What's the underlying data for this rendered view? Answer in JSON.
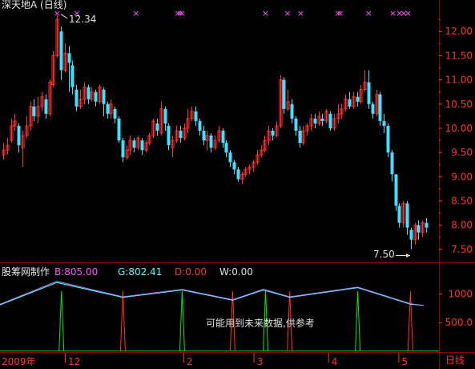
{
  "header": {
    "title": "深天地A (日线)"
  },
  "main_chart": {
    "high_label": "12.34",
    "low_label": "7.50",
    "y_ticks": [
      "12.00",
      "11.50",
      "11.00",
      "10.50",
      "10.00",
      "9.50",
      "9.00",
      "8.50",
      "8.00",
      "7.50"
    ],
    "signal_marker": "×"
  },
  "indicator": {
    "name": "股筹网制作",
    "b_label": "B:805.00",
    "g_label": "G:802.41",
    "d_label": "D:0.00",
    "w_label": "W:0.00",
    "y_ticks": [
      "1000",
      "500.0"
    ],
    "note": "可能用到未来数据,供参考",
    "colors": {
      "B": "#ff55ff",
      "G": "#55ffff",
      "D": "#ff3030",
      "W": "#e0e0e0"
    }
  },
  "time_axis": {
    "labels": [
      "2009年",
      "12",
      "2",
      "3",
      "4",
      "5"
    ],
    "period_button": "日线"
  },
  "colors": {
    "up": "#ff3030",
    "down": "#40e0ff",
    "grid": "#8b0000",
    "axis_text": "#ff3030",
    "signal": "#ff55ff"
  },
  "chart_data": {
    "type": "candlestick",
    "title": "深天地A (日线)",
    "price_ticks": [
      7.5,
      8.0,
      8.5,
      9.0,
      9.5,
      10.0,
      10.5,
      11.0,
      11.5,
      12.0
    ],
    "high_marked": 12.34,
    "low_marked": 7.5,
    "candles": [
      {
        "o": 9.45,
        "c": 9.55,
        "h": 9.7,
        "l": 9.35
      },
      {
        "o": 9.55,
        "c": 9.65,
        "h": 9.8,
        "l": 9.45
      },
      {
        "o": 9.75,
        "c": 10.05,
        "h": 10.2,
        "l": 9.7
      },
      {
        "o": 10.05,
        "c": 10.15,
        "h": 10.3,
        "l": 9.95
      },
      {
        "o": 10.05,
        "c": 9.65,
        "h": 10.1,
        "l": 9.5
      },
      {
        "o": 9.6,
        "c": 9.85,
        "h": 9.95,
        "l": 9.2
      },
      {
        "o": 9.85,
        "c": 10.05,
        "h": 10.25,
        "l": 9.8
      },
      {
        "o": 10.05,
        "c": 10.45,
        "h": 10.55,
        "l": 9.95
      },
      {
        "o": 10.45,
        "c": 10.25,
        "h": 10.6,
        "l": 10.15
      },
      {
        "o": 10.25,
        "c": 10.45,
        "h": 10.65,
        "l": 10.1
      },
      {
        "o": 10.45,
        "c": 10.65,
        "h": 10.75,
        "l": 10.35
      },
      {
        "o": 10.6,
        "c": 10.3,
        "h": 10.7,
        "l": 10.2
      },
      {
        "o": 10.3,
        "c": 10.95,
        "h": 11.0,
        "l": 10.25
      },
      {
        "o": 10.9,
        "c": 11.5,
        "h": 11.6,
        "l": 10.85
      },
      {
        "o": 11.5,
        "c": 12.25,
        "h": 12.34,
        "l": 11.45
      },
      {
        "o": 12.0,
        "c": 11.2,
        "h": 12.1,
        "l": 11.0
      },
      {
        "o": 11.2,
        "c": 11.55,
        "h": 11.75,
        "l": 11.15
      },
      {
        "o": 11.55,
        "c": 11.35,
        "h": 11.7,
        "l": 10.75
      },
      {
        "o": 11.3,
        "c": 10.85,
        "h": 11.4,
        "l": 10.7
      },
      {
        "o": 10.8,
        "c": 10.45,
        "h": 10.9,
        "l": 10.35
      },
      {
        "o": 10.45,
        "c": 10.6,
        "h": 10.8,
        "l": 10.4
      },
      {
        "o": 10.6,
        "c": 10.85,
        "h": 10.95,
        "l": 10.5
      },
      {
        "o": 10.85,
        "c": 10.6,
        "h": 10.9,
        "l": 10.5
      },
      {
        "o": 10.6,
        "c": 10.75,
        "h": 10.85,
        "l": 10.55
      },
      {
        "o": 10.75,
        "c": 10.55,
        "h": 10.8,
        "l": 10.45
      },
      {
        "o": 10.55,
        "c": 10.85,
        "h": 10.9,
        "l": 10.5
      },
      {
        "o": 10.8,
        "c": 10.5,
        "h": 10.85,
        "l": 10.25
      },
      {
        "o": 10.5,
        "c": 10.3,
        "h": 10.55,
        "l": 10.2
      },
      {
        "o": 10.3,
        "c": 10.5,
        "h": 10.6,
        "l": 10.2
      },
      {
        "o": 10.4,
        "c": 10.2,
        "h": 10.45,
        "l": 10.1
      },
      {
        "o": 10.2,
        "c": 9.75,
        "h": 10.25,
        "l": 9.7
      },
      {
        "o": 9.75,
        "c": 9.4,
        "h": 9.8,
        "l": 9.3
      },
      {
        "o": 9.4,
        "c": 9.55,
        "h": 9.65,
        "l": 9.35
      },
      {
        "o": 9.55,
        "c": 9.75,
        "h": 9.85,
        "l": 9.45
      },
      {
        "o": 9.75,
        "c": 9.6,
        "h": 9.8,
        "l": 9.5
      },
      {
        "o": 9.6,
        "c": 9.8,
        "h": 9.85,
        "l": 9.55
      },
      {
        "o": 9.75,
        "c": 9.55,
        "h": 9.8,
        "l": 9.45
      },
      {
        "o": 9.55,
        "c": 9.7,
        "h": 9.75,
        "l": 9.5
      },
      {
        "o": 9.7,
        "c": 9.85,
        "h": 9.9,
        "l": 9.65
      },
      {
        "o": 9.85,
        "c": 10.15,
        "h": 10.2,
        "l": 9.8
      },
      {
        "o": 10.1,
        "c": 9.95,
        "h": 10.2,
        "l": 9.85
      },
      {
        "o": 9.9,
        "c": 10.4,
        "h": 10.55,
        "l": 9.85
      },
      {
        "o": 10.4,
        "c": 10.1,
        "h": 10.45,
        "l": 9.95
      },
      {
        "o": 10.05,
        "c": 9.65,
        "h": 10.1,
        "l": 9.55
      },
      {
        "o": 9.6,
        "c": 9.75,
        "h": 9.85,
        "l": 9.4
      },
      {
        "o": 9.75,
        "c": 9.95,
        "h": 10.05,
        "l": 9.7
      },
      {
        "o": 9.95,
        "c": 9.8,
        "h": 10.05,
        "l": 9.7
      },
      {
        "o": 9.8,
        "c": 10.0,
        "h": 10.1,
        "l": 9.75
      },
      {
        "o": 10.0,
        "c": 10.2,
        "h": 10.4,
        "l": 9.9
      },
      {
        "o": 10.2,
        "c": 10.35,
        "h": 10.45,
        "l": 10.15
      },
      {
        "o": 10.35,
        "c": 10.15,
        "h": 10.45,
        "l": 10.05
      },
      {
        "o": 10.15,
        "c": 9.95,
        "h": 10.2,
        "l": 9.85
      },
      {
        "o": 9.95,
        "c": 9.75,
        "h": 10.05,
        "l": 9.65
      },
      {
        "o": 9.75,
        "c": 9.85,
        "h": 9.95,
        "l": 9.55
      },
      {
        "o": 9.85,
        "c": 9.6,
        "h": 9.9,
        "l": 9.5
      },
      {
        "o": 9.6,
        "c": 9.75,
        "h": 9.85,
        "l": 9.55
      },
      {
        "o": 9.75,
        "c": 9.95,
        "h": 10.05,
        "l": 9.7
      },
      {
        "o": 9.95,
        "c": 9.7,
        "h": 10.0,
        "l": 9.6
      },
      {
        "o": 9.7,
        "c": 9.5,
        "h": 9.75,
        "l": 9.4
      },
      {
        "o": 9.5,
        "c": 9.3,
        "h": 9.55,
        "l": 9.2
      },
      {
        "o": 9.3,
        "c": 9.15,
        "h": 9.35,
        "l": 9.05
      },
      {
        "o": 9.15,
        "c": 8.95,
        "h": 9.2,
        "l": 8.9
      },
      {
        "o": 8.95,
        "c": 9.05,
        "h": 9.1,
        "l": 8.85
      },
      {
        "o": 9.05,
        "c": 9.15,
        "h": 9.2,
        "l": 9.0
      },
      {
        "o": 9.15,
        "c": 9.2,
        "h": 9.25,
        "l": 9.05
      },
      {
        "o": 9.2,
        "c": 9.3,
        "h": 9.35,
        "l": 9.1
      },
      {
        "o": 9.3,
        "c": 9.45,
        "h": 9.55,
        "l": 9.25
      },
      {
        "o": 9.45,
        "c": 9.55,
        "h": 9.65,
        "l": 9.4
      },
      {
        "o": 9.55,
        "c": 9.75,
        "h": 9.85,
        "l": 9.5
      },
      {
        "o": 9.75,
        "c": 9.95,
        "h": 10.05,
        "l": 9.65
      },
      {
        "o": 9.95,
        "c": 9.85,
        "h": 10.0,
        "l": 9.75
      },
      {
        "o": 9.85,
        "c": 10.05,
        "h": 10.15,
        "l": 9.8
      },
      {
        "o": 10.05,
        "c": 11.0,
        "h": 11.1,
        "l": 10.0
      },
      {
        "o": 11.0,
        "c": 10.4,
        "h": 11.05,
        "l": 10.3
      },
      {
        "o": 10.4,
        "c": 10.55,
        "h": 10.8,
        "l": 10.35
      },
      {
        "o": 10.5,
        "c": 10.2,
        "h": 10.6,
        "l": 10.1
      },
      {
        "o": 10.2,
        "c": 9.95,
        "h": 10.25,
        "l": 9.85
      },
      {
        "o": 9.95,
        "c": 9.7,
        "h": 10.05,
        "l": 9.6
      },
      {
        "o": 9.7,
        "c": 9.95,
        "h": 10.05,
        "l": 9.65
      },
      {
        "o": 9.95,
        "c": 10.05,
        "h": 10.1,
        "l": 9.85
      },
      {
        "o": 10.05,
        "c": 10.2,
        "h": 10.3,
        "l": 9.95
      },
      {
        "o": 10.2,
        "c": 10.1,
        "h": 10.3,
        "l": 10.0
      },
      {
        "o": 10.1,
        "c": 10.25,
        "h": 10.35,
        "l": 10.05
      },
      {
        "o": 10.2,
        "c": 10.15,
        "h": 10.3,
        "l": 10.05
      },
      {
        "o": 10.15,
        "c": 10.35,
        "h": 10.4,
        "l": 10.1
      },
      {
        "o": 10.3,
        "c": 10.0,
        "h": 10.35,
        "l": 9.95
      },
      {
        "o": 10.0,
        "c": 10.2,
        "h": 10.3,
        "l": 9.95
      },
      {
        "o": 10.2,
        "c": 10.3,
        "h": 10.5,
        "l": 10.1
      },
      {
        "o": 10.3,
        "c": 10.4,
        "h": 10.5,
        "l": 10.2
      },
      {
        "o": 10.4,
        "c": 10.6,
        "h": 10.7,
        "l": 10.35
      },
      {
        "o": 10.6,
        "c": 10.45,
        "h": 10.75,
        "l": 10.4
      },
      {
        "o": 10.45,
        "c": 10.65,
        "h": 10.75,
        "l": 10.4
      },
      {
        "o": 10.65,
        "c": 10.55,
        "h": 10.75,
        "l": 10.45
      },
      {
        "o": 10.55,
        "c": 10.8,
        "h": 10.9,
        "l": 10.5
      },
      {
        "o": 10.8,
        "c": 10.95,
        "h": 11.2,
        "l": 10.75
      },
      {
        "o": 10.95,
        "c": 10.5,
        "h": 11.2,
        "l": 10.4
      },
      {
        "o": 10.5,
        "c": 10.3,
        "h": 10.55,
        "l": 10.2
      },
      {
        "o": 10.3,
        "c": 10.7,
        "h": 10.8,
        "l": 10.25
      },
      {
        "o": 10.7,
        "c": 10.15,
        "h": 10.75,
        "l": 10.05
      },
      {
        "o": 10.15,
        "c": 10.05,
        "h": 10.3,
        "l": 9.9
      },
      {
        "o": 10.05,
        "c": 9.5,
        "h": 10.1,
        "l": 9.4
      },
      {
        "o": 9.5,
        "c": 9.05,
        "h": 9.55,
        "l": 8.9
      },
      {
        "o": 9.05,
        "c": 8.4,
        "h": 9.05,
        "l": 8.3
      },
      {
        "o": 8.4,
        "c": 8.05,
        "h": 8.45,
        "l": 7.95
      },
      {
        "o": 8.05,
        "c": 8.45,
        "h": 8.5,
        "l": 7.95
      },
      {
        "o": 8.45,
        "c": 7.95,
        "h": 8.5,
        "l": 7.8
      },
      {
        "o": 7.9,
        "c": 7.7,
        "h": 7.95,
        "l": 7.5
      },
      {
        "o": 7.7,
        "c": 8.0,
        "h": 8.05,
        "l": 7.6
      },
      {
        "o": 8.0,
        "c": 7.85,
        "h": 8.1,
        "l": 7.7
      },
      {
        "o": 7.85,
        "c": 8.05,
        "h": 8.1,
        "l": 7.75
      },
      {
        "o": 8.05,
        "c": 7.95,
        "h": 8.15,
        "l": 7.85
      }
    ],
    "signal_x_fractions": [
      0.13,
      0.175,
      0.31,
      0.405,
      0.41,
      0.415,
      0.605,
      0.655,
      0.685,
      0.77,
      0.775,
      0.84,
      0.895,
      0.91,
      0.92,
      0.93
    ],
    "indicator": {
      "B_line": [
        [
          0.0,
          0.82
        ],
        [
          0.13,
          1.22
        ],
        [
          0.28,
          0.95
        ],
        [
          0.415,
          1.08
        ],
        [
          0.53,
          0.9
        ],
        [
          0.6,
          1.08
        ],
        [
          0.66,
          0.95
        ],
        [
          0.815,
          1.12
        ],
        [
          0.935,
          0.83
        ],
        [
          0.965,
          0.8
        ]
      ],
      "G_line": [
        [
          0.0,
          0.81
        ],
        [
          0.13,
          1.2
        ],
        [
          0.28,
          0.94
        ],
        [
          0.415,
          1.07
        ],
        [
          0.53,
          0.89
        ],
        [
          0.6,
          1.07
        ],
        [
          0.66,
          0.94
        ],
        [
          0.815,
          1.11
        ],
        [
          0.935,
          0.82
        ],
        [
          0.965,
          0.8
        ]
      ],
      "D_spikes": [
        0.28,
        0.53,
        0.66,
        0.935
      ],
      "W_spikes": [
        0.14,
        0.415,
        0.605,
        0.815
      ],
      "ylim": [
        0,
        1300
      ]
    }
  }
}
